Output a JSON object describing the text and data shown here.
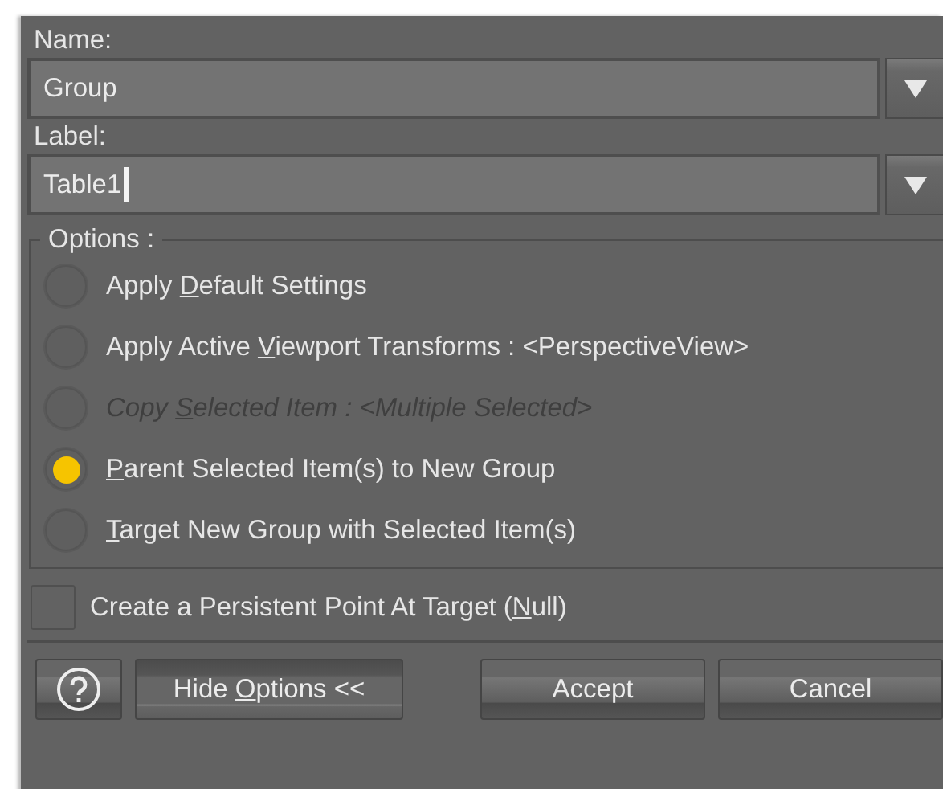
{
  "name_field": {
    "label": "Name:",
    "value": "Group"
  },
  "label_field": {
    "label": "Label:",
    "value": "Table1",
    "focused": true
  },
  "options": {
    "title": "Options :",
    "items": [
      {
        "before": "Apply ",
        "mnemonic": "D",
        "after": "efault Settings",
        "selected": false,
        "disabled": false
      },
      {
        "before": "Apply Active ",
        "mnemonic": "V",
        "after": "iewport Transforms : <PerspectiveView>",
        "selected": false,
        "disabled": false
      },
      {
        "before": "Copy ",
        "mnemonic": "S",
        "after": "elected Item : <Multiple Selected>",
        "selected": false,
        "disabled": true
      },
      {
        "mnemonic": "P",
        "after": "arent Selected Item(s) to New Group",
        "selected": true,
        "disabled": false
      },
      {
        "mnemonic": "T",
        "after": "arget New Group with Selected Item(s)",
        "selected": false,
        "disabled": false
      }
    ]
  },
  "persistent_null": {
    "before": "Create a Persistent Point At Target (",
    "mnemonic": "N",
    "after": "ull)",
    "checked": false
  },
  "buttons": [
    {
      "kind": "help"
    },
    {
      "kind": "toggle",
      "before": "Hide ",
      "mnemonic": "O",
      "after": "ptions <<"
    },
    {
      "kind": "push",
      "before": "Accept"
    },
    {
      "kind": "push",
      "before": "Cancel"
    }
  ]
}
